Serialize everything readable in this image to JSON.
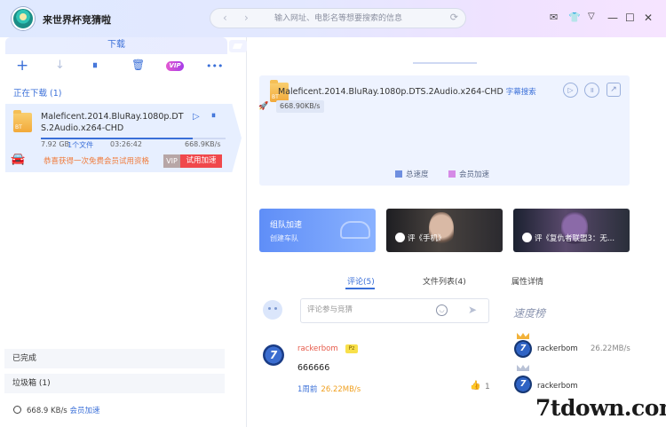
{
  "app": {
    "title": "来世界杯竞猜啦"
  },
  "address_bar": {
    "placeholder": "输入网址、电影名等想要搜索的信息"
  },
  "left_panel": {
    "tab_label": "下载",
    "toolbar": {
      "vip_label": "VIP",
      "more_label": "•••"
    },
    "downloading_header": "正在下载 (1)",
    "task": {
      "file_badge": "BT",
      "name": "Maleficent.2014.BluRay.1080p.DTS.2Audio.x264-CHD",
      "size": "7.92 GB",
      "file_count": "1个文件",
      "time_left": "03:26:42",
      "speed": "668.9KB/s",
      "progress": 0.82,
      "promo_text": "恭喜获得一次免费会员试用资格",
      "vip_tag": "VIP",
      "trial_button": "试用加速"
    },
    "completed_label": "已完成",
    "trash_label": "垃圾箱 (1)",
    "status": {
      "speed": "668.9 KB/s",
      "link": "会员加速"
    }
  },
  "right_panel": {
    "detail": {
      "file_badge": "BT",
      "name": "Maleficent.2014.BluRay.1080p.DTS.2Audio.x264-CHD",
      "subtitle_search": "字幕搜索",
      "speed": "668.90KB/s",
      "legend_total": "总速度",
      "legend_vip": "会员加速",
      "legend_total_color": "#6f8fe0",
      "legend_vip_color": "#d58ae6"
    },
    "banners": {
      "team_title": "组队加速",
      "team_sub": "创建车队",
      "movie1": "评《手机》",
      "movie2": "评《复仇者联盟3：无..."
    },
    "tabs": {
      "comments": "评论(5)",
      "files": "文件列表(4)",
      "properties": "属性详情"
    },
    "comment_input": {
      "placeholder": "评论参与竞猜"
    },
    "speed_ranking_title": "速度榜",
    "comment": {
      "avatar_glyph": "7",
      "user": "rackerbom",
      "level": "Pz",
      "text": "666666",
      "time": "1周前",
      "speed": "26.22MB/s",
      "likes": "1"
    },
    "ranking": [
      {
        "user": "rackerbom",
        "speed": "26.22MB/s",
        "avatar_glyph": "7"
      },
      {
        "user": "rackerbom",
        "speed": "",
        "avatar_glyph": "7"
      }
    ]
  },
  "watermark": "7tdown.com"
}
